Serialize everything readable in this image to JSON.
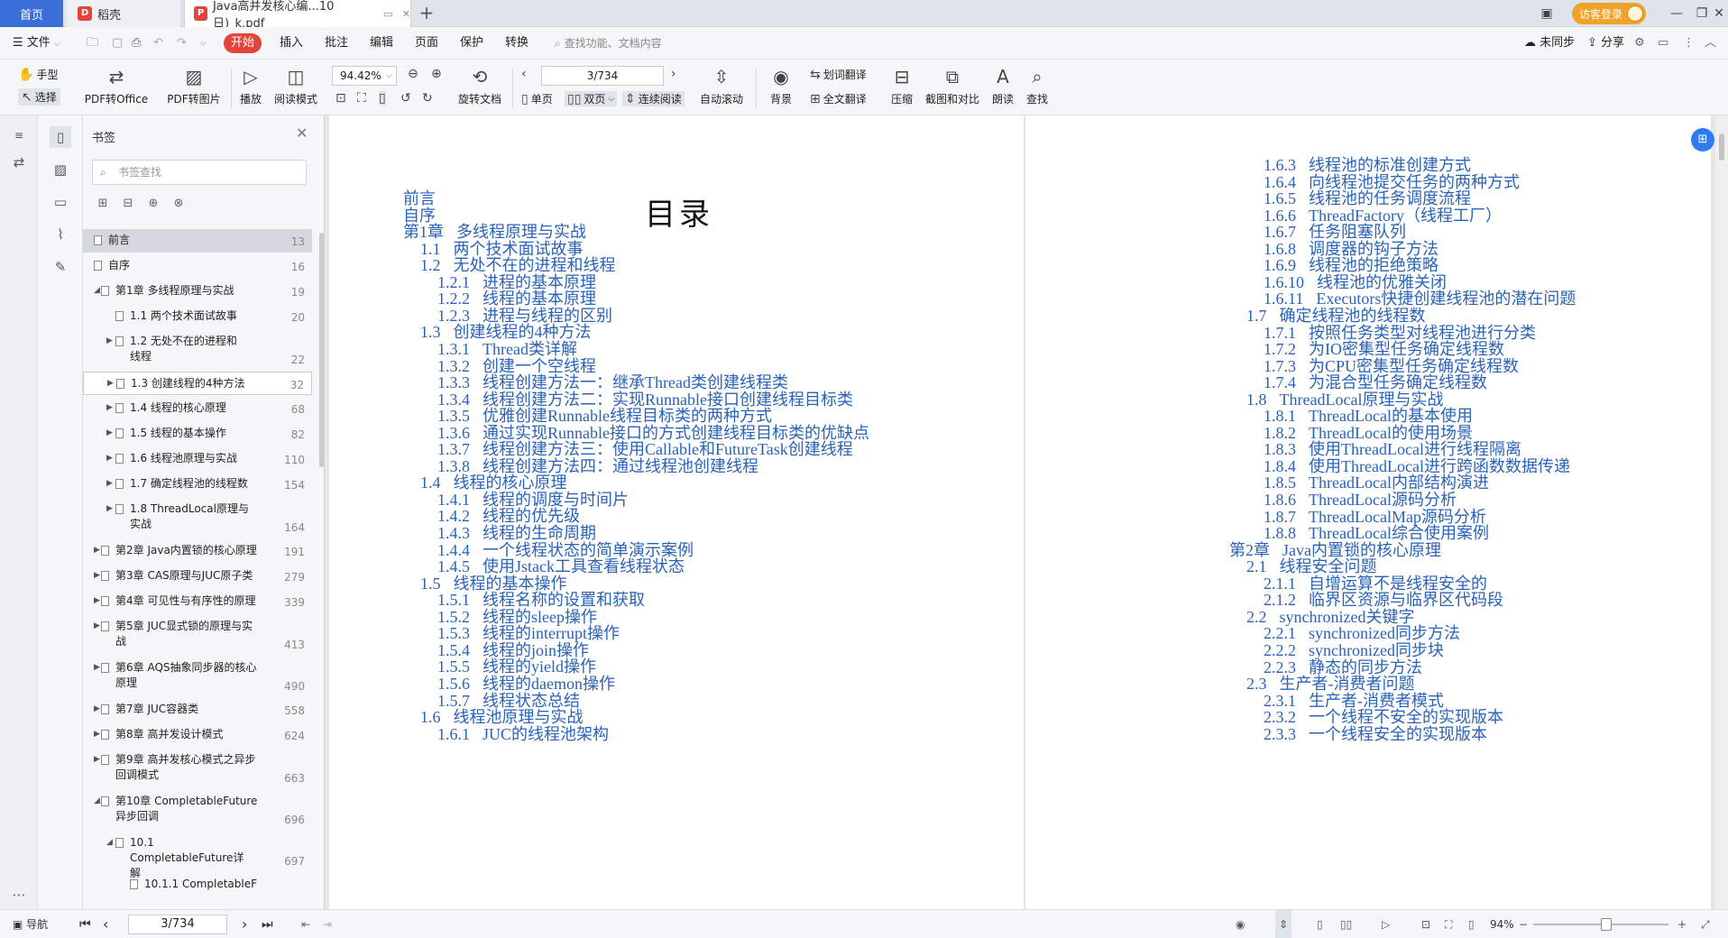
{
  "tabs": {
    "home": "首页",
    "daoke": "稻壳",
    "pdf": "Java高并发核心编...10日)_k.pdf"
  },
  "header": {
    "visitor_login": "访客登录"
  },
  "menu": {
    "file": "文件",
    "start": "开始",
    "items": [
      "插入",
      "批注",
      "编辑",
      "页面",
      "保护",
      "转换"
    ],
    "search_placeholder": "查找功能、文档内容",
    "right": {
      "unsync": "未同步",
      "share": "分享"
    }
  },
  "toolbar": {
    "hand": "手型",
    "select": "选择",
    "pdf_to_office": "PDF转Office",
    "pdf_to_image": "PDF转图片",
    "play": "播放",
    "read_mode": "阅读模式",
    "zoom": "94.42%",
    "rotate": "旋转文档",
    "single": "单页",
    "double": "双页",
    "continuous": "连续阅读",
    "page_input": "3/734",
    "auto_scroll": "自动滚动",
    "background": "背景",
    "translate_word": "划词翻译",
    "translate_full": "全文翻译",
    "compress": "压缩",
    "screenshot_compare": "截图和对比",
    "read_aloud": "朗读",
    "find": "查找"
  },
  "bookmarks": {
    "title": "书签",
    "search_placeholder": "书签查找",
    "items": [
      {
        "label": "前言",
        "page": "13"
      },
      {
        "label": "自序",
        "page": "16"
      },
      {
        "label": "第1章 多线程原理与实战",
        "page": "19"
      },
      {
        "label": "1.1 两个技术面试故事",
        "page": "20"
      },
      {
        "label": "1.2 无处不在的进程和线程",
        "page": "22"
      },
      {
        "label": "1.3 创建线程的4种方法",
        "page": "32"
      },
      {
        "label": "1.4 线程的核心原理",
        "page": "68"
      },
      {
        "label": "1.5 线程的基本操作",
        "page": "82"
      },
      {
        "label": "1.6 线程池原理与实战",
        "page": "110"
      },
      {
        "label": "1.7 确定线程池的线程数",
        "page": "154"
      },
      {
        "label": "1.8 ThreadLocal原理与实战",
        "page": "164"
      },
      {
        "label": "第2章 Java内置锁的核心原理",
        "page": "191"
      },
      {
        "label": "第3章 CAS原理与JUC原子类",
        "page": "279"
      },
      {
        "label": "第4章 可见性与有序性的原理",
        "page": "339"
      },
      {
        "label": "第5章 JUC显式锁的原理与实战",
        "page": "413"
      },
      {
        "label": "第6章 AQS抽象同步器的核心原理",
        "page": "490"
      },
      {
        "label": "第7章 JUC容器类",
        "page": "558"
      },
      {
        "label": "第8章 高并发设计模式",
        "page": "624"
      },
      {
        "label": "第9章 高并发核心模式之异步回调模式",
        "page": "663"
      },
      {
        "label": "第10章 CompletableFuture异步回调",
        "page": "696"
      },
      {
        "label": "10.1 CompletableFuture详解",
        "page": "697"
      },
      {
        "label": "10.1.1 CompletableF",
        "page": ""
      }
    ]
  },
  "document": {
    "toc_title": "目录",
    "left_column": [
      [
        "",
        "前言"
      ],
      [
        "",
        "自序"
      ],
      [
        "第1章",
        "多线程原理与实战"
      ],
      [
        "1.1",
        "两个技术面试故事"
      ],
      [
        "1.2",
        "无处不在的进程和线程"
      ],
      [
        "1.2.1",
        "进程的基本原理"
      ],
      [
        "1.2.2",
        "线程的基本原理"
      ],
      [
        "1.2.3",
        "进程与线程的区别"
      ],
      [
        "1.3",
        "创建线程的4种方法"
      ],
      [
        "1.3.1",
        "Thread类详解"
      ],
      [
        "1.3.2",
        "创建一个空线程"
      ],
      [
        "1.3.3",
        "线程创建方法一：继承Thread类创建线程类"
      ],
      [
        "1.3.4",
        "线程创建方法二：实现Runnable接口创建线程目标类"
      ],
      [
        "1.3.5",
        "优雅创建Runnable线程目标类的两种方式"
      ],
      [
        "1.3.6",
        "通过实现Runnable接口的方式创建线程目标类的优缺点"
      ],
      [
        "1.3.7",
        "线程创建方法三：使用Callable和FutureTask创建线程"
      ],
      [
        "1.3.8",
        "线程创建方法四：通过线程池创建线程"
      ],
      [
        "1.4",
        "线程的核心原理"
      ],
      [
        "1.4.1",
        "线程的调度与时间片"
      ],
      [
        "1.4.2",
        "线程的优先级"
      ],
      [
        "1.4.3",
        "线程的生命周期"
      ],
      [
        "1.4.4",
        "一个线程状态的简单演示案例"
      ],
      [
        "1.4.5",
        "使用Jstack工具查看线程状态"
      ],
      [
        "1.5",
        "线程的基本操作"
      ],
      [
        "1.5.1",
        "线程名称的设置和获取"
      ],
      [
        "1.5.2",
        "线程的sleep操作"
      ],
      [
        "1.5.3",
        "线程的interrupt操作"
      ],
      [
        "1.5.4",
        "线程的join操作"
      ],
      [
        "1.5.5",
        "线程的yield操作"
      ],
      [
        "1.5.6",
        "线程的daemon操作"
      ],
      [
        "1.5.7",
        "线程状态总结"
      ],
      [
        "1.6",
        "线程池原理与实战"
      ],
      [
        "1.6.1",
        "JUC的线程池架构"
      ]
    ],
    "right_column": [
      [
        "1.6.3",
        "线程池的标准创建方式"
      ],
      [
        "1.6.4",
        "向线程池提交任务的两种方式"
      ],
      [
        "1.6.5",
        "线程池的任务调度流程"
      ],
      [
        "1.6.6",
        "ThreadFactory（线程工厂）"
      ],
      [
        "1.6.7",
        "任务阻塞队列"
      ],
      [
        "1.6.8",
        "调度器的钩子方法"
      ],
      [
        "1.6.9",
        "线程池的拒绝策略"
      ],
      [
        "1.6.10",
        "线程池的优雅关闭"
      ],
      [
        "1.6.11",
        "Executors快捷创建线程池的潜在问题"
      ],
      [
        "1.7",
        "确定线程池的线程数"
      ],
      [
        "1.7.1",
        "按照任务类型对线程池进行分类"
      ],
      [
        "1.7.2",
        "为IO密集型任务确定线程数"
      ],
      [
        "1.7.3",
        "为CPU密集型任务确定线程数"
      ],
      [
        "1.7.4",
        "为混合型任务确定线程数"
      ],
      [
        "1.8",
        "ThreadLocal原理与实战"
      ],
      [
        "1.8.1",
        "ThreadLocal的基本使用"
      ],
      [
        "1.8.2",
        "ThreadLocal的使用场景"
      ],
      [
        "1.8.3",
        "使用ThreadLocal进行线程隔离"
      ],
      [
        "1.8.4",
        "使用ThreadLocal进行跨函数数据传递"
      ],
      [
        "1.8.5",
        "ThreadLocal内部结构演进"
      ],
      [
        "1.8.6",
        "ThreadLocal源码分析"
      ],
      [
        "1.8.7",
        "ThreadLocalMap源码分析"
      ],
      [
        "1.8.8",
        "ThreadLocal综合使用案例"
      ],
      [
        "第2章",
        "Java内置锁的核心原理"
      ],
      [
        "2.1",
        "线程安全问题"
      ],
      [
        "2.1.1",
        "自增运算不是线程安全的"
      ],
      [
        "2.1.2",
        "临界区资源与临界区代码段"
      ],
      [
        "2.2",
        "synchronized关键字"
      ],
      [
        "2.2.1",
        "synchronized同步方法"
      ],
      [
        "2.2.2",
        "synchronized同步块"
      ],
      [
        "2.2.3",
        "静态的同步方法"
      ],
      [
        "2.3",
        "生产者-消费者问题"
      ],
      [
        "2.3.1",
        "生产者-消费者模式"
      ],
      [
        "2.3.2",
        "一个线程不安全的实现版本"
      ],
      [
        "2.3.3",
        "一个线程安全的实现版本"
      ]
    ]
  },
  "statusbar": {
    "nav": "导航",
    "page": "3/734",
    "zoom": "94%"
  }
}
